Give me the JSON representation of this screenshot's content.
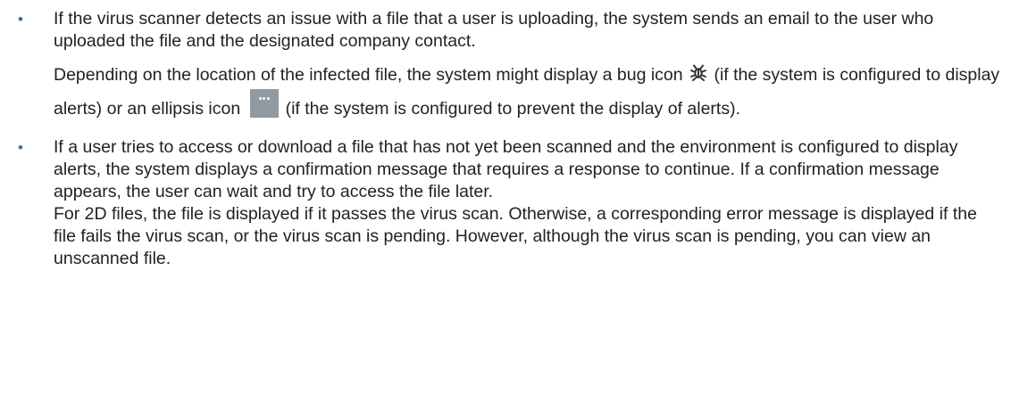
{
  "bullets": [
    {
      "paragraphs": {
        "p1": "If the virus scanner detects an issue with a file that a user is uploading, the system sends an email to the user who uploaded the file and the designated company contact.",
        "p2_before_bug": "Depending on the location of the infected file, the system might display a bug icon",
        "p2_after_bug": "(if the system is configured to display alerts) or an ellipsis icon",
        "p2_after_ellipsis": "(if the system is configured to prevent the display of alerts)."
      }
    },
    {
      "paragraphs": {
        "p1": "If a user tries to access or download a file that has not yet been scanned and the environment is configured to display alerts, the system displays a confirmation message that requires a response to continue. If a confirmation message appears, the user can wait and try to access the file later.",
        "p2": "For 2D files, the file is displayed if it passes the virus scan. Otherwise, a corresponding error message is displayed if the file fails the virus scan, or the virus scan is pending. However, although the virus scan is pending, you can view an unscanned file."
      }
    }
  ],
  "icons": {
    "bullet": "bullet-dot",
    "bug": "bug-icon",
    "ellipsis": "ellipsis-icon",
    "bullet_color": "#3a6e9c",
    "ellipsis_bg": "#8f9aa3"
  }
}
